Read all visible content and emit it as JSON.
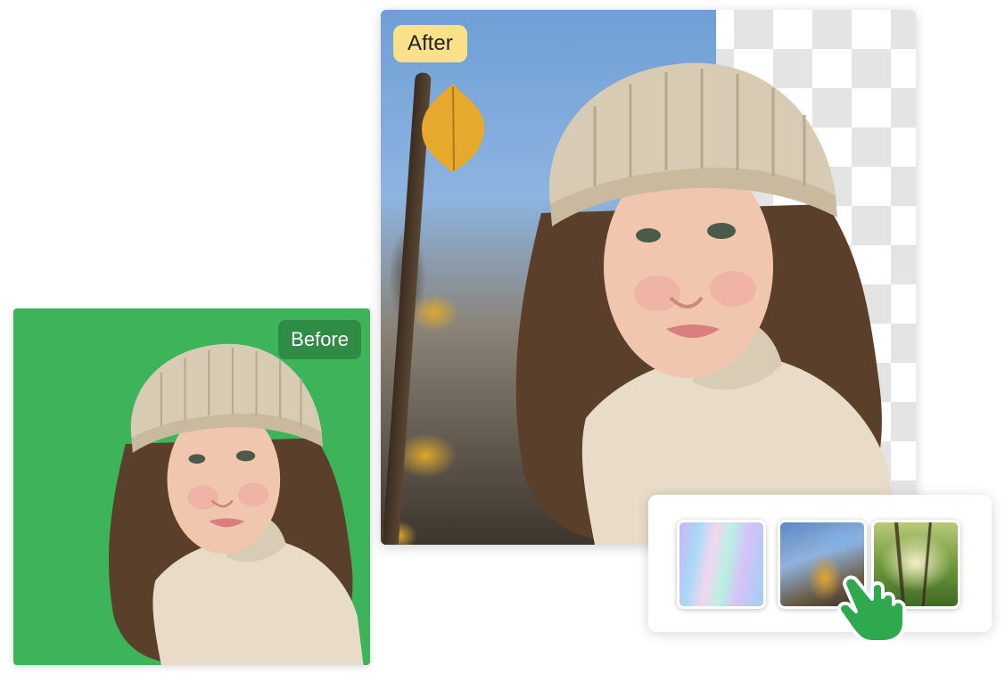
{
  "after_card": {
    "label": "After",
    "label_color": "#fbe08a",
    "background": "transparent-checkerboard"
  },
  "before_card": {
    "label": "Before",
    "background_color": "#3db35a",
    "label_color": "#2f8c44"
  },
  "background_picker": {
    "options": [
      {
        "name": "rainbow-gradient-background"
      },
      {
        "name": "autumn-sky-background"
      },
      {
        "name": "forest-background"
      }
    ],
    "pointer_icon": "hand-pointer-icon",
    "pointer_color": "#2fa94e"
  }
}
